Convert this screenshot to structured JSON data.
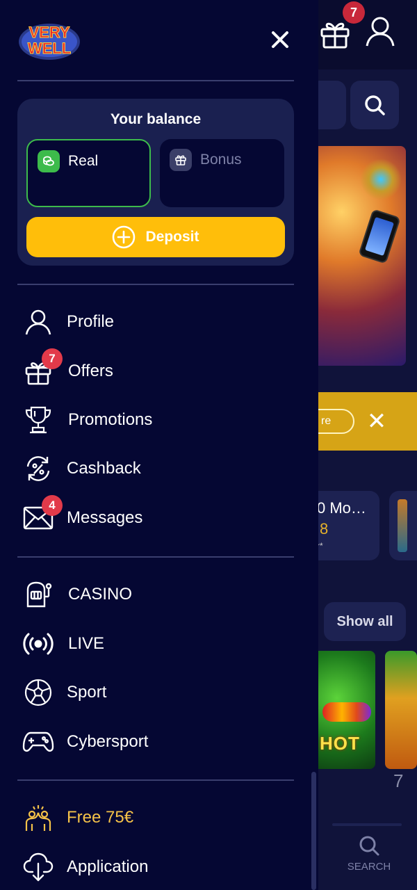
{
  "background": {
    "header_gift_badge": "7",
    "promo_button_label": "re",
    "game_card_title": "0 Mo…",
    "game_card_value": "8",
    "game_card_note": "r*",
    "show_all_label": "Show all",
    "game_label": "HOT",
    "row_number": "7",
    "tab_search_label": "SEARCH"
  },
  "drawer": {
    "logo_text_top": "VERY",
    "logo_text_bottom": "WELL",
    "balance": {
      "title": "Your balance",
      "real_label": "Real",
      "bonus_label": "Bonus",
      "deposit_label": "Deposit"
    },
    "account_menu": [
      {
        "label": "Profile",
        "icon": "user-icon"
      },
      {
        "label": "Offers",
        "icon": "gift-icon",
        "badge": "7"
      },
      {
        "label": "Promotions",
        "icon": "trophy-icon"
      },
      {
        "label": "Cashback",
        "icon": "cashback-icon"
      },
      {
        "label": "Messages",
        "icon": "envelope-icon",
        "badge": "4"
      }
    ],
    "product_menu": [
      {
        "label": "CASINO",
        "icon": "slot-machine-icon"
      },
      {
        "label": "LIVE",
        "icon": "live-broadcast-icon"
      },
      {
        "label": "Sport",
        "icon": "soccer-ball-icon"
      },
      {
        "label": "Cybersport",
        "icon": "gamepad-icon"
      }
    ],
    "extra_menu": [
      {
        "label": "Free 75€",
        "icon": "celebration-icon",
        "highlight": true
      },
      {
        "label": "Application",
        "icon": "cloud-download-icon"
      }
    ]
  },
  "colors": {
    "drawer_bg": "#050733",
    "accent_yellow": "#ffbe0a",
    "real_green": "#3dbb4b",
    "badge_red": "#e23a4a",
    "highlight_gold": "#f5c249"
  }
}
